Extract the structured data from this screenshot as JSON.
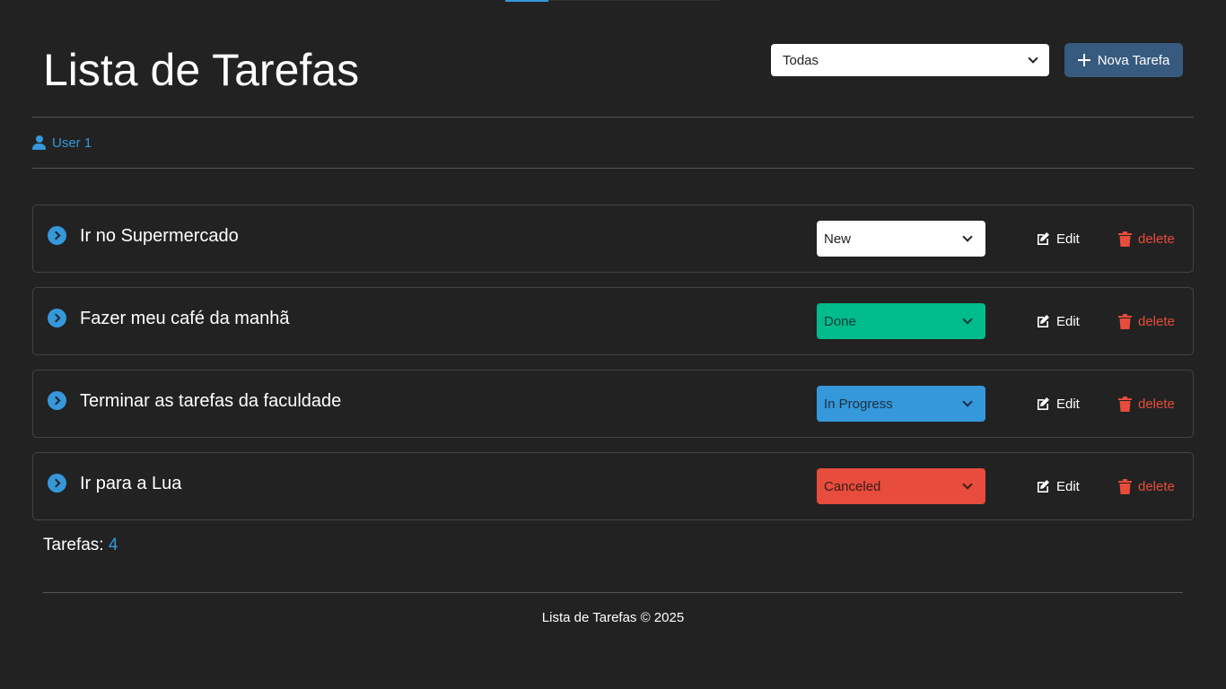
{
  "colors": {
    "background": "#222222",
    "accent": "#3498db",
    "primary_button": "#375a7f",
    "status_new": "#ffffff",
    "status_done": "#00bc8c",
    "status_in_progress": "#3498db",
    "status_canceled": "#e74c3c",
    "delete": "#e74c3c"
  },
  "header": {
    "title": "Lista de Tarefas",
    "filter": {
      "selected": "Todas"
    },
    "new_task_label": "Nova Tarefa"
  },
  "user": {
    "name": "User 1",
    "icon": "user-icon"
  },
  "tasks": [
    {
      "title": "Ir no Supermercado",
      "status": "New",
      "edit_label": "Edit",
      "delete_label": "delete"
    },
    {
      "title": "Fazer meu café da manhã",
      "status": "Done",
      "edit_label": "Edit",
      "delete_label": "delete"
    },
    {
      "title": "Terminar as tarefas da faculdade",
      "status": "In Progress",
      "edit_label": "Edit",
      "delete_label": "delete"
    },
    {
      "title": "Ir para a Lua",
      "status": "Canceled",
      "edit_label": "Edit",
      "delete_label": "delete"
    }
  ],
  "summary": {
    "label": "Tarefas:",
    "count": "4"
  },
  "footer": {
    "text": "Lista de Tarefas © 2025"
  }
}
